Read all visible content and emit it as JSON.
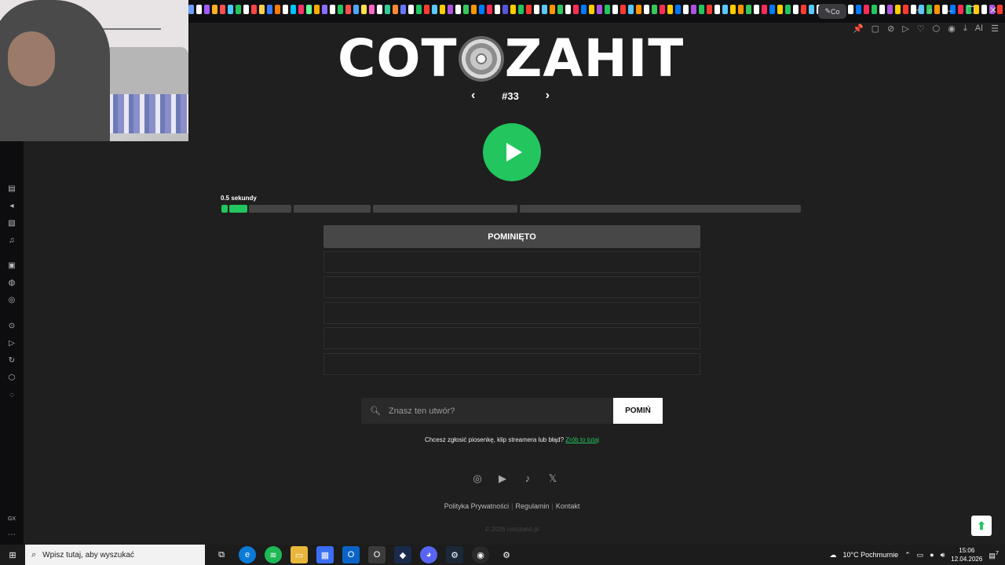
{
  "browser": {
    "active_tab_label": "Co",
    "tab_colors": [
      "#6aa0ff",
      "#ffffff",
      "#a05cff",
      "#ffb020",
      "#ff5050",
      "#4ec9ff",
      "#22c55e",
      "#ffffff",
      "#ff4444",
      "#ffd24a",
      "#3a7bff",
      "#ff7a00",
      "#ffffff",
      "#00c3ff",
      "#ff3366",
      "#66ff99",
      "#ffaa00",
      "#8e6bff",
      "#ffffff",
      "#22c55e",
      "#ff4d4d",
      "#4da6ff",
      "#ffe04a",
      "#ff66cc",
      "#ffffff",
      "#33cc99",
      "#ff8833",
      "#6677ff",
      "#ffffff",
      "#22c55e",
      "#ff3b30",
      "#5ac8fa",
      "#ffcc00",
      "#af52de",
      "#ffffff",
      "#34c759",
      "#ff9500",
      "#007aff",
      "#ff2d55",
      "#ffffff",
      "#5856d6",
      "#ffcc00",
      "#22c55e",
      "#ff3b30",
      "#ffffff",
      "#5ac8fa",
      "#ff9500",
      "#34c759",
      "#ffffff",
      "#ff2d55",
      "#007aff",
      "#ffcc00",
      "#af52de",
      "#22c55e",
      "#ffffff",
      "#ff3b30",
      "#5ac8fa",
      "#ff9500",
      "#ffffff",
      "#34c759",
      "#ff2d55",
      "#ffcc00",
      "#007aff",
      "#ffffff",
      "#af52de",
      "#22c55e",
      "#ff3b30",
      "#ffffff",
      "#5ac8fa",
      "#ffcc00",
      "#ff9500",
      "#34c759",
      "#ffffff",
      "#ff2d55",
      "#007aff",
      "#ffcc00",
      "#22c55e",
      "#ffffff",
      "#ff3b30",
      "#5ac8fa",
      "#ffffff",
      "#ff9500",
      "#34c759",
      "#ffcc00",
      "#ffffff",
      "#007aff",
      "#ff2d55",
      "#22c55e",
      "#ffffff",
      "#af52de",
      "#ffcc00",
      "#ff3b30",
      "#ffffff",
      "#5ac8fa",
      "#34c759",
      "#ff9500",
      "#ffffff",
      "#007aff",
      "#ff2d55",
      "#22c55e",
      "#ffcc00",
      "#ffffff",
      "#af52de",
      "#ff3b30"
    ],
    "new_tab_icon": "plus-icon",
    "window_controls": [
      "search-icon",
      "minimize-icon",
      "restore-icon",
      "close-icon"
    ]
  },
  "game": {
    "logo_left": "COT",
    "logo_right": "ZAHIT",
    "number": "#33",
    "duration_label": "0.5 sekundy",
    "skipped_label": "POMINIĘTO",
    "search_placeholder": "Znasz ten utwór?",
    "skip_button": "POMIŃ",
    "report_text": "Chcesz zgłosić piosenkę, klip streamera lub błąd?",
    "report_link": "Zrób to tutaj",
    "footer_links": [
      "Polityka Prywatności",
      "Regulamin",
      "Kontakt"
    ],
    "copyright": "© 2026 cotozahit.pl",
    "accent": "#22c55e",
    "socials": [
      "instagram-icon",
      "youtube-icon",
      "tiktok-icon",
      "x-icon"
    ]
  },
  "taskbar": {
    "search_placeholder": "Wpisz tutaj, aby wyszukać",
    "weather": "10°C  Pochmurnie",
    "time": "15:06",
    "date": "12.04.2026",
    "notification_count": "7"
  },
  "sidebar": {
    "bottom_label": "GX"
  }
}
